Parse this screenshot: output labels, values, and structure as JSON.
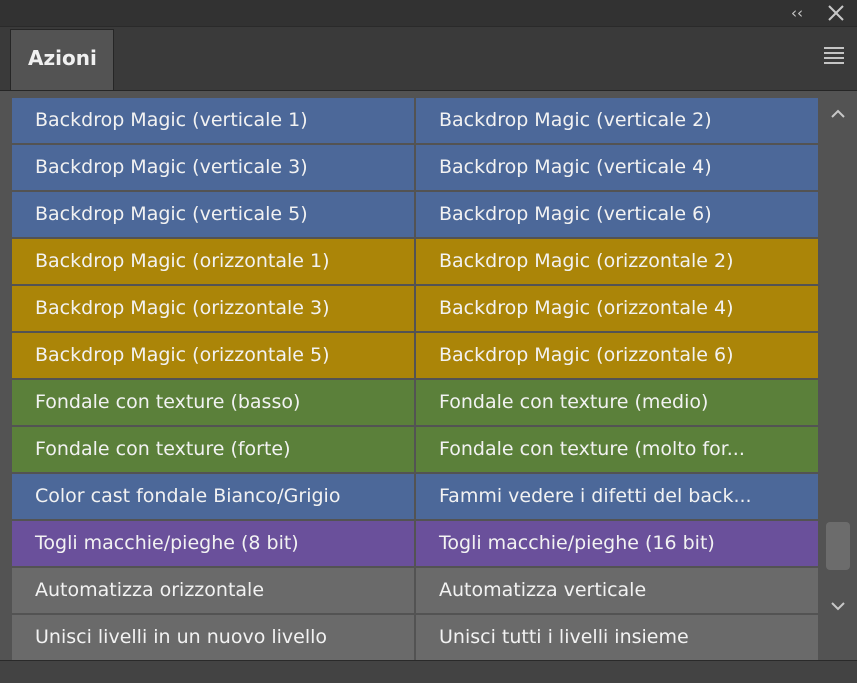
{
  "window": {
    "collapse_label": "‹‹"
  },
  "tab": {
    "label": "Azioni"
  },
  "actions": [
    [
      {
        "label": "Backdrop Magic (verticale 1)",
        "color": "blue"
      },
      {
        "label": "Backdrop Magic (verticale 2)",
        "color": "blue"
      }
    ],
    [
      {
        "label": "Backdrop Magic (verticale 3)",
        "color": "blue"
      },
      {
        "label": "Backdrop Magic (verticale 4)",
        "color": "blue"
      }
    ],
    [
      {
        "label": "Backdrop Magic (verticale 5)",
        "color": "blue"
      },
      {
        "label": "Backdrop Magic (verticale 6)",
        "color": "blue"
      }
    ],
    [
      {
        "label": "Backdrop Magic (orizzontale 1)",
        "color": "gold"
      },
      {
        "label": "Backdrop Magic (orizzontale 2)",
        "color": "gold"
      }
    ],
    [
      {
        "label": "Backdrop Magic (orizzontale 3)",
        "color": "gold"
      },
      {
        "label": "Backdrop Magic (orizzontale 4)",
        "color": "gold"
      }
    ],
    [
      {
        "label": "Backdrop Magic (orizzontale 5)",
        "color": "gold"
      },
      {
        "label": "Backdrop Magic (orizzontale 6)",
        "color": "gold"
      }
    ],
    [
      {
        "label": "Fondale con texture (basso)",
        "color": "green"
      },
      {
        "label": "Fondale con texture (medio)",
        "color": "green"
      }
    ],
    [
      {
        "label": "Fondale con texture (forte)",
        "color": "green"
      },
      {
        "label": "Fondale con texture (molto for...",
        "color": "green"
      }
    ],
    [
      {
        "label": "Color cast fondale Bianco/Grigio",
        "color": "blue"
      },
      {
        "label": "Fammi vedere i difetti del back...",
        "color": "blue"
      }
    ],
    [
      {
        "label": "Togli macchie/pieghe (8 bit)",
        "color": "purple"
      },
      {
        "label": "Togli macchie/pieghe (16 bit)",
        "color": "purple"
      }
    ],
    [
      {
        "label": "Automatizza orizzontale",
        "color": "gray"
      },
      {
        "label": "Automatizza verticale",
        "color": "gray"
      }
    ],
    [
      {
        "label": "Unisci livelli in un nuovo livello",
        "color": "gray"
      },
      {
        "label": "Unisci tutti i livelli insieme",
        "color": "gray"
      }
    ]
  ],
  "colors": {
    "blue": "#4c6899",
    "gold": "#ab8508",
    "green": "#5b803a",
    "purple": "#6a509b",
    "gray": "#6a6a6a"
  },
  "scrollbar": {
    "position_fraction": 0.9
  }
}
